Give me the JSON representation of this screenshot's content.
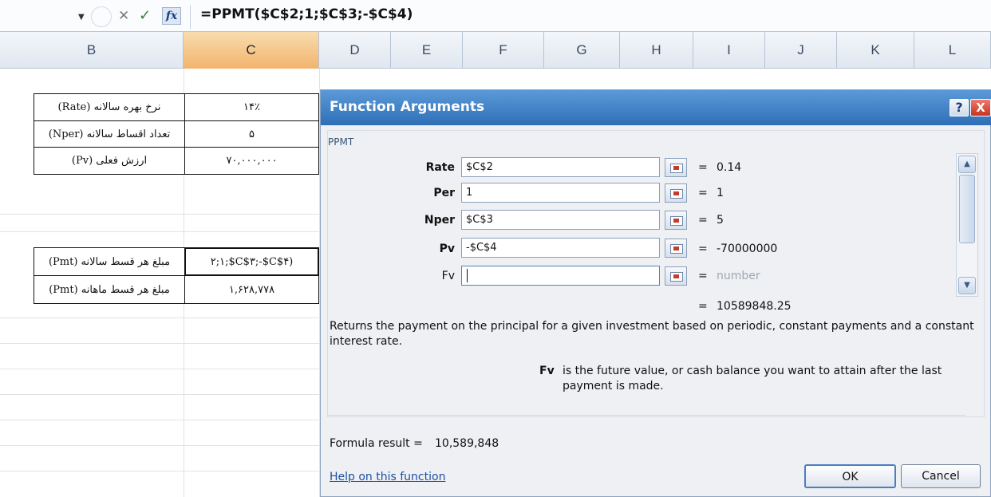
{
  "formula_bar": {
    "dropdown_icon": "dropdown-arrow",
    "cancel_glyph": "✕",
    "enter_glyph": "✓",
    "fx_label": "fx",
    "formula": "=PPMT($C$2;1;$C$3;-$C$4)"
  },
  "columns": [
    "B",
    "C",
    "D",
    "E",
    "F",
    "G",
    "H",
    "I",
    "J",
    "K",
    "L"
  ],
  "selected_column": "C",
  "sheet": {
    "rows": [
      {
        "label": "نرخ بهره سالانه (Rate)",
        "value": "۱۴٪"
      },
      {
        "label": "تعداد اقساط سالانه (Nper)",
        "value": "۵"
      },
      {
        "label": "ارزش فعلی (Pv)",
        "value": "۷۰,۰۰۰,۰۰۰"
      },
      {
        "label": "مبلغ هر قسط سالانه (Pmt)",
        "value": "۲;۱;$C$۳;-$C$۴)"
      },
      {
        "label": "مبلغ هر قسط ماهانه (Pmt)",
        "value": "۱,۶۲۸,۷۷۸"
      }
    ]
  },
  "dialog": {
    "title": "Function Arguments",
    "help_glyph": "?",
    "close_glyph": "X",
    "function_name": "PPMT",
    "args": [
      {
        "label": "Rate",
        "input": "$C$2",
        "equals": "=",
        "value": "0.14"
      },
      {
        "label": "Per",
        "input": "1",
        "equals": "=",
        "value": "1"
      },
      {
        "label": "Nper",
        "input": "$C$3",
        "equals": "=",
        "value": "5"
      },
      {
        "label": "Pv",
        "input": "-$C$4",
        "equals": "=",
        "value": "-70000000"
      },
      {
        "label": "Fv",
        "input": "",
        "equals": "=",
        "value": "number"
      }
    ],
    "result_equals": "=",
    "result_value": "10589848.25",
    "description": "Returns the payment on the principal for a given investment based on periodic, constant payments and a constant interest rate.",
    "description_line1": "Returns the payment on the principal for a given investment based on periodic, constant payments and a constant",
    "description_line2": "interest rate.",
    "arg_help_name": "Fv",
    "arg_help_line1": "is the future value, or cash balance you want to attain after the last",
    "arg_help_line2": "payment is made.",
    "formula_result_label": "Formula result =",
    "formula_result_value": "10,589,848",
    "help_link": "Help on this function",
    "ok_label": "OK",
    "cancel_label": "Cancel"
  },
  "colors": {
    "title_bar": "#2f6fb7",
    "selected_column": "#f2b46c",
    "link": "#1d4fa3"
  }
}
